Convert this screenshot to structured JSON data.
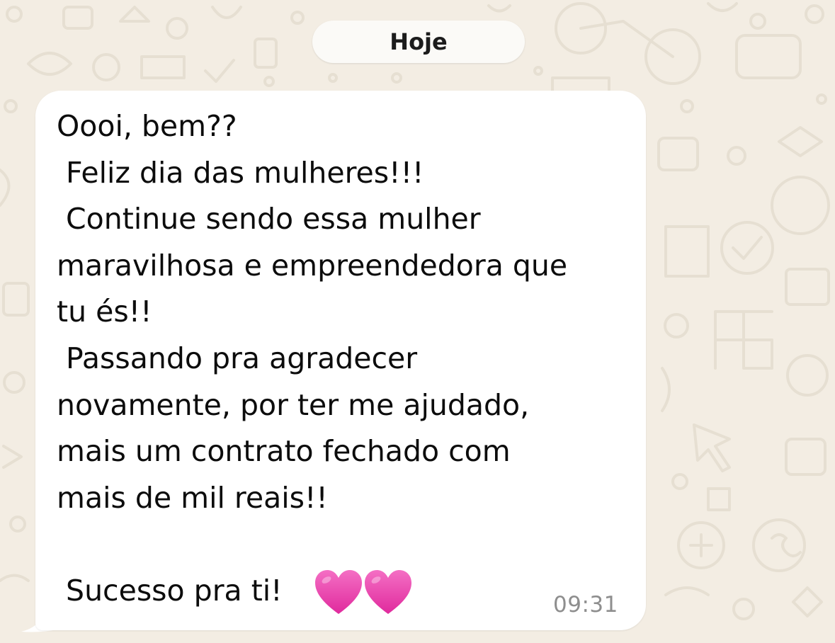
{
  "chat": {
    "date_separator": "Hoje",
    "message": {
      "text": "Oooi, bem??\n Feliz dia das mulheres!!!\n Continue sendo essa mulher\nmaravilhosa e empreendedora que\ntu és!!\n Passando pra agradecer\nnovamente, por ter me ajudado,\nmais um contrato fechado com\nmais de mil reais!!\n\n Sucesso pra ti!",
      "emoji_icons": [
        "pink-heart-icon",
        "pink-heart-icon"
      ],
      "time": "09:31",
      "direction": "incoming"
    }
  },
  "colors": {
    "wallpaper": "#f3ede3",
    "wallpaper_doodle": "#e6dfd2",
    "bubble": "#ffffff",
    "date_pill": "#fbfaf7",
    "text": "#0c0c0c",
    "timestamp": "#8e8e8e",
    "heart": "#e83aa8"
  }
}
